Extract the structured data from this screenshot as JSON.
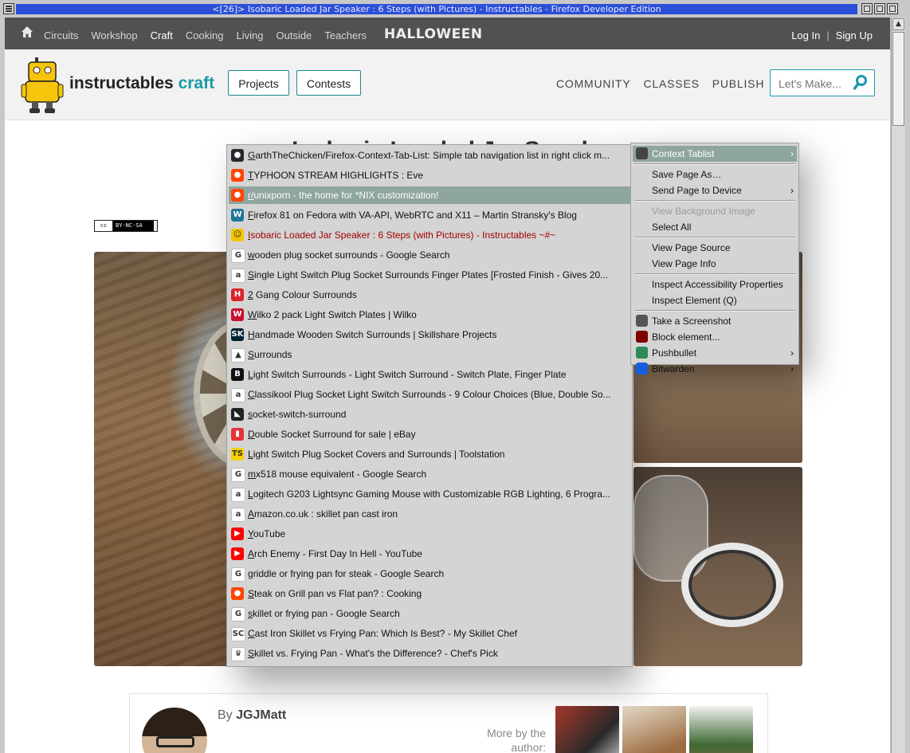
{
  "window": {
    "title": "<[26]> Isobaric Loaded Jar Speaker : 6 Steps (with Pictures) - Instructables - Firefox Developer Edition"
  },
  "site": {
    "nav": {
      "home_icon": "home-icon",
      "categories": [
        "Circuits",
        "Workshop",
        "Craft",
        "Cooking",
        "Living",
        "Outside",
        "Teachers"
      ],
      "active_category": "Craft",
      "promo": "HALLOWEEN",
      "login": "Log In",
      "separator": "|",
      "signup": "Sign Up"
    },
    "header": {
      "brand_main": "instructables",
      "brand_sub": "craft",
      "projects_button": "Projects",
      "contests_button": "Contests",
      "links": [
        "COMMUNITY",
        "CLASSES",
        "PUBLISH"
      ],
      "search_placeholder": "Let's Make..."
    },
    "article": {
      "title_partial": "Isobaric Loaded Jar Speaker",
      "license_badge": "BY-NC-SA",
      "license_cc": "cc"
    },
    "author": {
      "by": "By",
      "name": "JGJMatt",
      "more_by": "More by the author:"
    }
  },
  "tablist": {
    "items": [
      {
        "favicon": "github-icon",
        "color": "#24292e",
        "glyph": "●",
        "label": "GarthTheChicken/Firefox-Context-Tab-List: Simple tab navigation list in right click m..."
      },
      {
        "favicon": "reddit-icon",
        "color": "#ff4500",
        "glyph": "●",
        "label": "TYPHOON STREAM HIGHLIGHTS : Eve"
      },
      {
        "favicon": "reddit-icon",
        "color": "#ff4500",
        "glyph": "●",
        "label": "r/unixporn - the home for *NIX customization!",
        "highlight": true
      },
      {
        "favicon": "wordpress-icon",
        "color": "#21759b",
        "glyph": "W",
        "label": "Firefox 81 on Fedora with VA-API, WebRTC and X11 – Martin Stransky's Blog"
      },
      {
        "favicon": "instructables-icon",
        "color": "#f5c400",
        "glyph": "☺",
        "label": "Isobaric Loaded Jar Speaker : 6 Steps (with Pictures) - Instructables ~#~",
        "current": true
      },
      {
        "favicon": "google-icon",
        "color": "#ffffff",
        "glyph": "G",
        "label": "wooden plug socket surrounds - Google Search"
      },
      {
        "favicon": "amazon-icon",
        "color": "#ffffff",
        "glyph": "a",
        "label": "Single Light Switch Plug Socket Surrounds Finger Plates [Frosted Finish - Gives 20..."
      },
      {
        "favicon": "hamilton-icon",
        "color": "#d9252a",
        "glyph": "H",
        "label": "2 Gang Colour Surrounds"
      },
      {
        "favicon": "wilko-icon",
        "color": "#c8102e",
        "glyph": "W",
        "label": "Wilko 2 pack Light Switch Plates | Wilko"
      },
      {
        "favicon": "skillshare-icon",
        "color": "#002333",
        "glyph": "SK",
        "label": "Handmade Wooden Switch Surrounds | Skillshare Projects"
      },
      {
        "favicon": "generic-site-icon",
        "color": "#ffffff",
        "glyph": "▲",
        "label": "Surrounds"
      },
      {
        "favicon": "b-icon",
        "color": "#111111",
        "glyph": "B",
        "label": "Light Switch Surrounds - Light Switch Surround - Switch Plate, Finger Plate"
      },
      {
        "favicon": "amazon-icon",
        "color": "#ffffff",
        "glyph": "a",
        "label": "Classikool Plug Socket  Light Switch Surrounds - 9 Colour Choices (Blue, Double So..."
      },
      {
        "favicon": "generic-dark-icon",
        "color": "#222222",
        "glyph": "◣",
        "label": "socket-switch-surround"
      },
      {
        "favicon": "ebay-icon",
        "color": "#e53238",
        "glyph": "▮",
        "label": "Double Socket Surround for sale | eBay"
      },
      {
        "favicon": "toolstation-icon",
        "color": "#f8d100",
        "glyph": "TS",
        "label": "Light Switch  Plug Socket Covers and Surrounds | Toolstation"
      },
      {
        "favicon": "google-icon",
        "color": "#ffffff",
        "glyph": "G",
        "label": "mx518 mouse equivalent - Google Search"
      },
      {
        "favicon": "amazon-icon",
        "color": "#ffffff",
        "glyph": "a",
        "label": "Logitech G203 Lightsync Gaming Mouse with Customizable RGB Lighting, 6 Progra..."
      },
      {
        "favicon": "amazon-icon",
        "color": "#ffffff",
        "glyph": "a",
        "label": "Amazon.co.uk : skillet pan cast iron"
      },
      {
        "favicon": "youtube-icon",
        "color": "#ff0000",
        "glyph": "▶",
        "label": "YouTube"
      },
      {
        "favicon": "youtube-icon",
        "color": "#ff0000",
        "glyph": "▶",
        "label": "Arch Enemy - First Day In Hell - YouTube"
      },
      {
        "favicon": "google-icon",
        "color": "#ffffff",
        "glyph": "G",
        "label": "griddle or frying pan for steak - Google Search"
      },
      {
        "favicon": "reddit-icon",
        "color": "#ff4500",
        "glyph": "●",
        "label": "Steak on Grill pan vs Flat pan? : Cooking"
      },
      {
        "favicon": "google-icon",
        "color": "#ffffff",
        "glyph": "G",
        "label": "skillet or frying pan - Google Search"
      },
      {
        "favicon": "skilletchef-icon",
        "color": "#ffffff",
        "glyph": "SC",
        "label": "Cast Iron Skillet vs Frying Pan: Which Is Best? - My Skillet Chef"
      },
      {
        "favicon": "chefspick-icon",
        "color": "#ffffff",
        "glyph": "♛",
        "label": "Skillet vs. Frying Pan - What's the Difference? - Chef's Pick"
      }
    ]
  },
  "context_menu": {
    "items": [
      {
        "label": "Context Tablist",
        "icon": "tablist-icon",
        "submenu": true,
        "highlight": true
      },
      {
        "separator": true
      },
      {
        "label": "Save Page As…"
      },
      {
        "label": "Send Page to Device",
        "submenu": true
      },
      {
        "separator": true
      },
      {
        "label": "View Background Image",
        "disabled": true
      },
      {
        "label": "Select All"
      },
      {
        "separator": true
      },
      {
        "label": "View Page Source"
      },
      {
        "label": "View Page Info"
      },
      {
        "separator": true
      },
      {
        "label": "Inspect Accessibility Properties"
      },
      {
        "label": "Inspect Element (Q)"
      },
      {
        "separator": true
      },
      {
        "label": "Take a Screenshot",
        "icon": "screenshot-icon"
      },
      {
        "label": "Block element...",
        "icon": "ublock-icon"
      },
      {
        "label": "Pushbullet",
        "icon": "pushbullet-icon",
        "submenu": true
      },
      {
        "label": "Bitwarden",
        "icon": "bitwarden-icon",
        "submenu": true
      }
    ]
  }
}
